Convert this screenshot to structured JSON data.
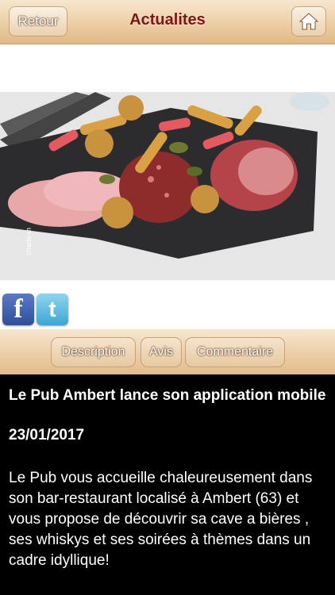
{
  "header": {
    "back_label": "Retour",
    "title": "Actualites",
    "home_icon": "home-icon"
  },
  "social": {
    "facebook_icon": "facebook-icon",
    "facebook_glyph": "f",
    "twitter_icon": "twitter-icon",
    "twitter_glyph": "t"
  },
  "photo": {
    "watermark": "charlo-m"
  },
  "tabs": [
    {
      "label": "Description"
    },
    {
      "label": "Avis"
    },
    {
      "label": "Commentaire"
    }
  ],
  "article": {
    "headline": "Le Pub Ambert lance son application mobile",
    "date": "23/01/2017",
    "body": "Le Pub vous accueille chaleureusement dans son bar-restaurant localisé à Ambert (63) et vous propose de découvrir sa cave a bières , ses whiskys et ses soirées à thèmes dans un cadre idyllique!"
  },
  "colors": {
    "header_gradient_top": "#f7e6cf",
    "header_gradient_bottom": "#e1b985",
    "title": "#7d1616",
    "content_bg": "#000000",
    "content_text": "#ffffff"
  }
}
